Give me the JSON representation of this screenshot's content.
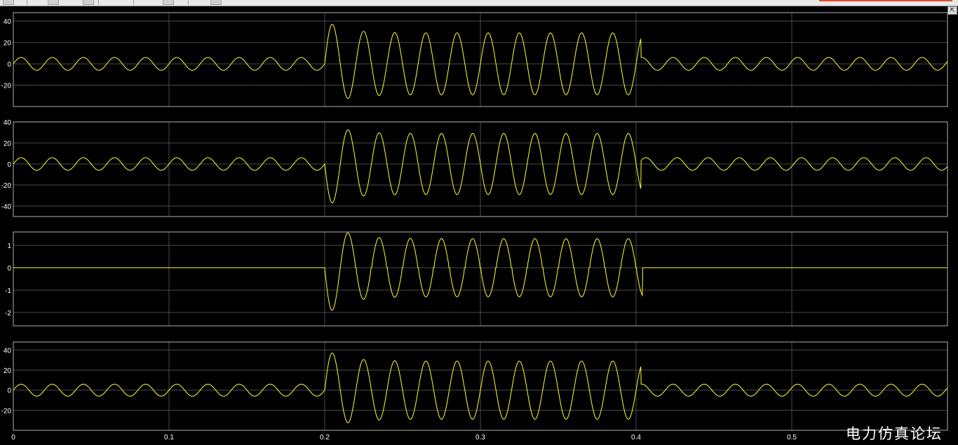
{
  "watermark": "电力仿真论坛",
  "colors": {
    "background": "#000000",
    "axes_edge": "#b0b0b0",
    "grid": "#4a4a4a",
    "tick_text": "#ffffff",
    "trace": "#ffff33",
    "toolbar": "#e8e8e8"
  },
  "icons": [
    "toolbar-button-icon",
    "restore-icon"
  ],
  "chart_data": [
    {
      "type": "line",
      "title": "",
      "xlabel": "",
      "ylabel": "",
      "xlim": [
        0,
        0.6
      ],
      "ylim": [
        -40,
        48
      ],
      "yticks": [
        -20,
        0,
        20,
        40
      ],
      "xticks": [
        0.1,
        0.2,
        0.3,
        0.4,
        0.5
      ],
      "x_tick_labels_shown": false,
      "grid": true,
      "series": [
        {
          "signal": {
            "f": 50,
            "pre_amp": 6,
            "fault_start": 0.2,
            "fault_end": 0.403,
            "fault_amp": 29,
            "fault_phase": 0,
            "decay_amp": 12,
            "decay_tau": 0.012,
            "post_phase": 0.4,
            "clip_abs": 0
          },
          "points": [
            [
              0,
              0
            ],
            [
              0.005,
              6
            ],
            [
              0.015,
              -6
            ],
            [
              0.2,
              0
            ],
            [
              0.205,
              39
            ],
            [
              0.215,
              -25
            ],
            [
              0.225,
              29
            ],
            [
              0.395,
              29
            ],
            [
              0.4,
              -28
            ],
            [
              0.403,
              5
            ],
            [
              0.6,
              0
            ]
          ]
        }
      ]
    },
    {
      "type": "line",
      "title": "",
      "xlabel": "",
      "ylabel": "",
      "xlim": [
        0,
        0.6
      ],
      "ylim": [
        -50,
        40
      ],
      "yticks": [
        -40,
        -20,
        0,
        20,
        40
      ],
      "xticks": [
        0.1,
        0.2,
        0.3,
        0.4,
        0.5
      ],
      "x_tick_labels_shown": false,
      "grid": true,
      "series": [
        {
          "signal": {
            "f": 50,
            "pre_amp": 6,
            "fault_start": 0.2,
            "fault_end": 0.403,
            "fault_amp": -29,
            "fault_phase": 0,
            "decay_amp": -12,
            "decay_tau": 0.012,
            "post_phase": -0.4,
            "clip_abs": 0
          },
          "points": [
            [
              0,
              0
            ],
            [
              0.005,
              -6
            ],
            [
              0.015,
              6
            ],
            [
              0.2,
              0
            ],
            [
              0.205,
              -41
            ],
            [
              0.215,
              27
            ],
            [
              0.225,
              -29
            ],
            [
              0.395,
              -29
            ],
            [
              0.4,
              30
            ],
            [
              0.403,
              -5
            ],
            [
              0.6,
              0
            ]
          ]
        }
      ]
    },
    {
      "type": "line",
      "title": "",
      "xlabel": "",
      "ylabel": "",
      "xlim": [
        0,
        0.6
      ],
      "ylim": [
        -2.6,
        1.6
      ],
      "yticks": [
        -2,
        -1,
        0,
        1
      ],
      "xticks": [
        0.1,
        0.2,
        0.3,
        0.4,
        0.5
      ],
      "x_tick_labels_shown": false,
      "grid": true,
      "series": [
        {
          "signal": {
            "f": 50,
            "pre_amp": 0,
            "fault_start": 0.2,
            "fault_end": 0.404,
            "fault_amp": -1.3,
            "fault_phase": 0,
            "decay_amp": -0.9,
            "decay_tau": 0.012,
            "post_phase": 0,
            "clip_abs": 0.12
          },
          "points": [
            [
              0,
              0
            ],
            [
              0.2,
              0
            ],
            [
              0.205,
              -2.2
            ],
            [
              0.215,
              0.9
            ],
            [
              0.225,
              -1.3
            ],
            [
              0.395,
              1.3
            ],
            [
              0.4,
              1.3
            ],
            [
              0.404,
              0
            ],
            [
              0.6,
              0
            ]
          ]
        }
      ]
    },
    {
      "type": "line",
      "title": "",
      "xlabel": "",
      "ylabel": "",
      "xlim": [
        0,
        0.6
      ],
      "ylim": [
        -40,
        48
      ],
      "yticks": [
        -20,
        0,
        20,
        40
      ],
      "xticks": [
        0,
        0.1,
        0.2,
        0.3,
        0.4,
        0.5
      ],
      "x_tick_labels": [
        "0",
        "0.1",
        "0.2",
        "0.3",
        "0.4",
        "0.5"
      ],
      "x_tick_labels_shown": true,
      "grid": true,
      "series": [
        {
          "signal": {
            "f": 50,
            "pre_amp": 6,
            "fault_start": 0.2,
            "fault_end": 0.403,
            "fault_amp": 29,
            "fault_phase": 0,
            "decay_amp": 12,
            "decay_tau": 0.012,
            "post_phase": 0.4,
            "clip_abs": 0
          },
          "points": [
            [
              0,
              0
            ],
            [
              0.005,
              6
            ],
            [
              0.015,
              -6
            ],
            [
              0.2,
              0
            ],
            [
              0.205,
              40
            ],
            [
              0.215,
              -26
            ],
            [
              0.225,
              29
            ],
            [
              0.395,
              29
            ],
            [
              0.4,
              -29
            ],
            [
              0.403,
              5
            ],
            [
              0.6,
              0
            ]
          ]
        }
      ]
    }
  ]
}
